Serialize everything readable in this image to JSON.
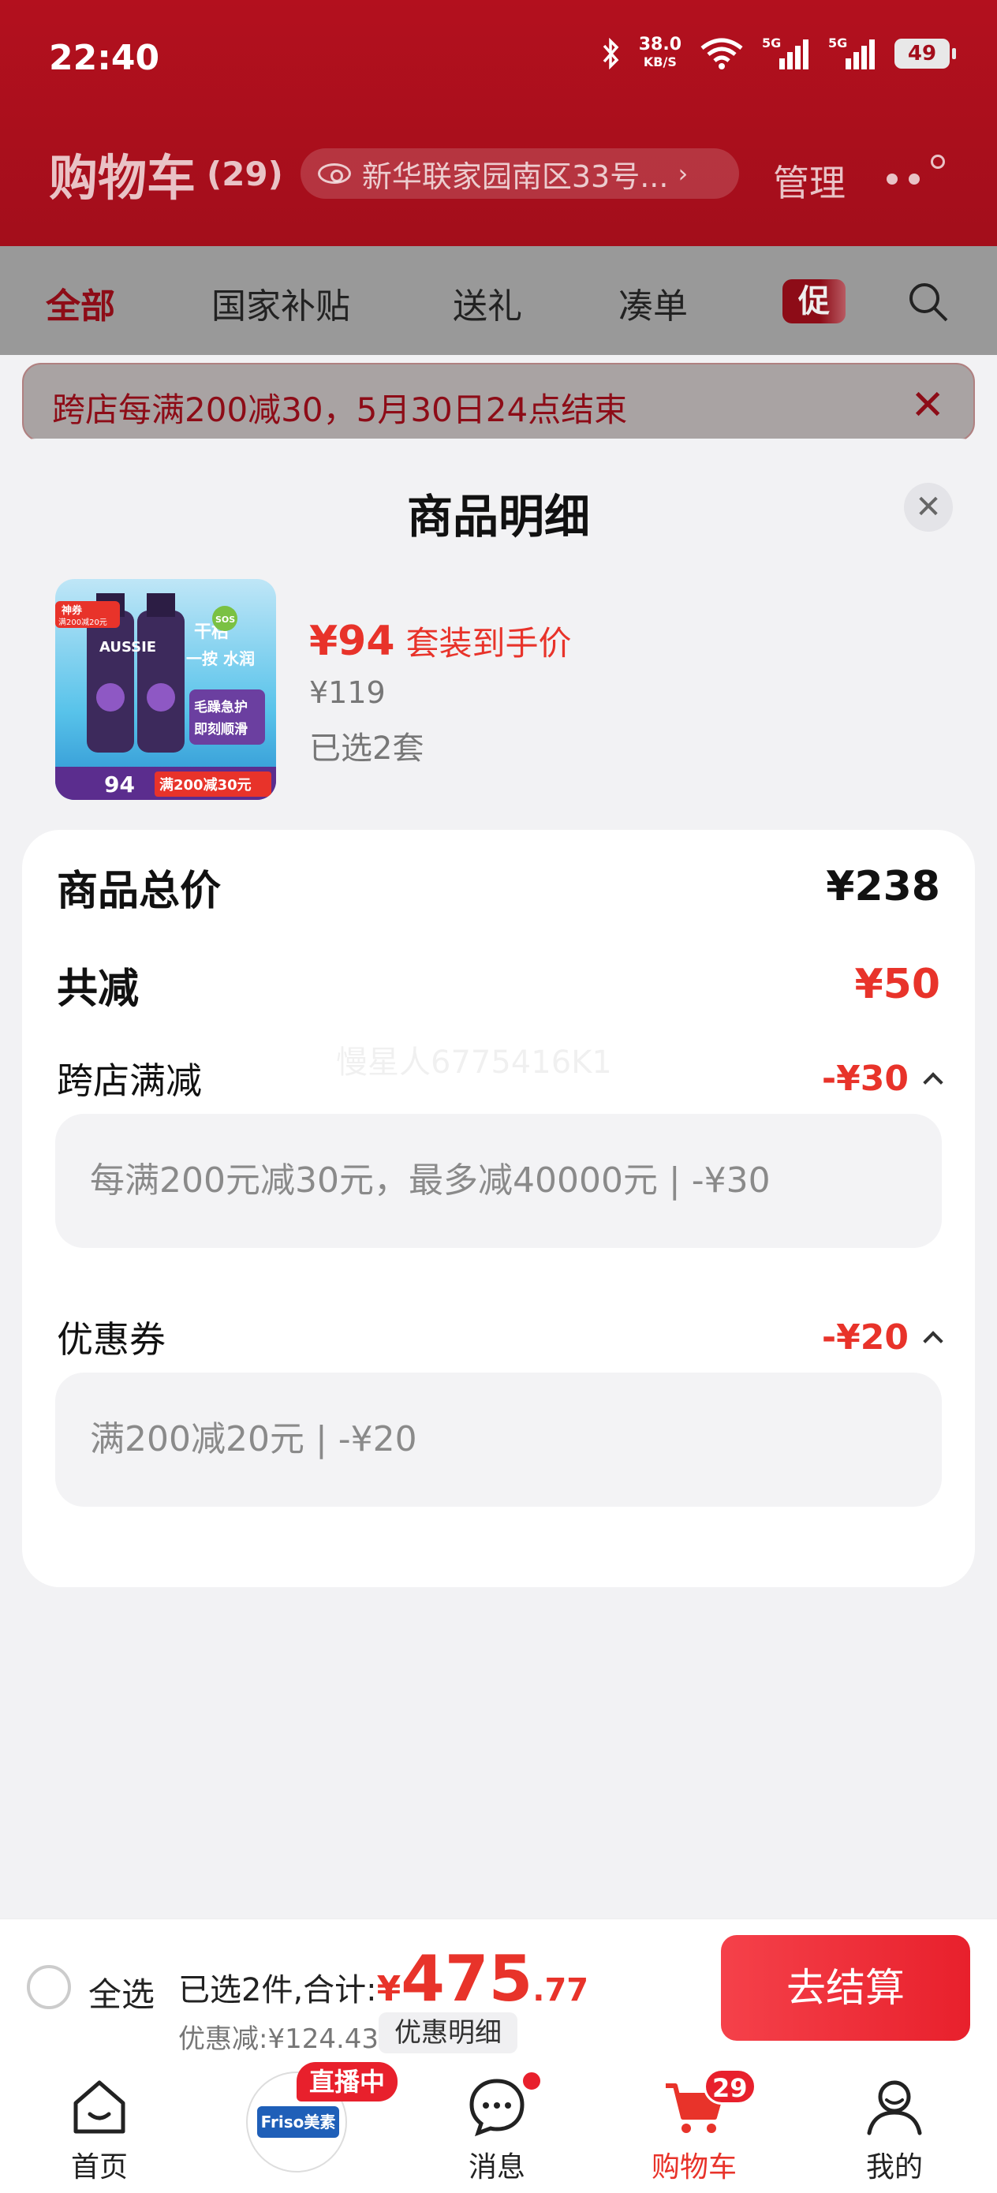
{
  "status_bar": {
    "time": "22:40",
    "speed_value": "38.0",
    "speed_unit": "KB/S",
    "net1": "5G",
    "net2": "5G",
    "battery": "49"
  },
  "header": {
    "title": "购物车",
    "count": "(29)",
    "address": "新华联家园南区33号...",
    "manage": "管理"
  },
  "tabs": [
    "全部",
    "国家补贴",
    "送礼",
    "凑单"
  ],
  "promo_tag": "促",
  "notice": {
    "text": "跨店每满200减30，5月30日24点结束",
    "close": "✕"
  },
  "sheet": {
    "title": "商品明细",
    "close": "✕",
    "product": {
      "price_now": "¥94",
      "price_label": "套装到手价",
      "price_orig": "¥119",
      "selected": "已选2套",
      "img_brand": "AUSSIE",
      "img_tag1": "神券",
      "img_tag2": "满200减20元",
      "img_slogan1": "干枯",
      "img_slogan2": "一按 水润",
      "img_sos": "SOS",
      "img_feature1": "毛躁急护",
      "img_feature2": "即刻顺滑",
      "img_price": "94",
      "img_promo": "满200减30元"
    },
    "summary": {
      "total_label": "商品总价",
      "total_value": "¥238",
      "reduce_label": "共减",
      "reduce_value": "¥50",
      "cross_store_label": "跨店满减",
      "cross_store_value": "-¥30",
      "cross_store_detail": "每满200元减30元，最多减40000元 | -¥30",
      "coupon_label": "优惠券",
      "coupon_value": "-¥20",
      "coupon_detail": "满200减20元 | -¥20",
      "watermark": "慢星人6775416K1"
    }
  },
  "checkout": {
    "select_all": "全选",
    "selected_total_label": "已选2件,合计:",
    "currency": "¥",
    "total_int": "475",
    "total_dec": ".77",
    "discount": "优惠减:¥124.43",
    "discount_detail_button": "优惠明细",
    "checkout_button": "去结算"
  },
  "tabbar": {
    "items": [
      {
        "label": "首页"
      },
      {
        "label": "直播中",
        "brand": "Friso美素佳儿"
      },
      {
        "label": "消息"
      },
      {
        "label": "购物车",
        "badge": "29"
      },
      {
        "label": "我的"
      }
    ]
  },
  "colors": {
    "brand_red": "#e8332a",
    "header_red": "#b3101e",
    "sheet_bg": "#f2f2f4"
  }
}
